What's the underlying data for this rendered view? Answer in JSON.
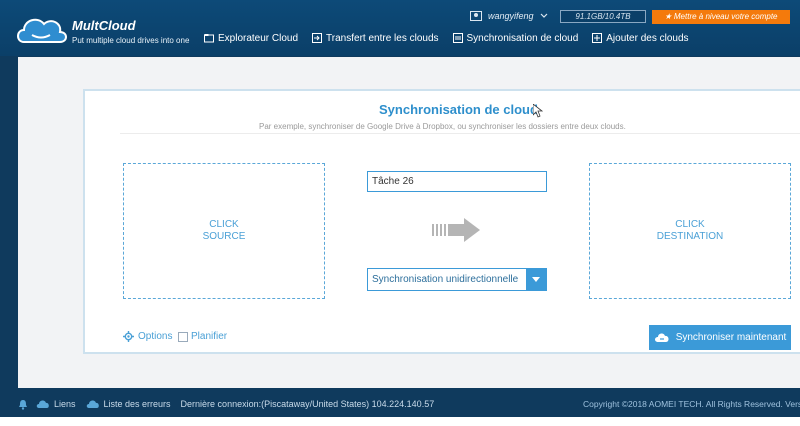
{
  "header": {
    "brand": "MultCloud",
    "tagline": "Put multiple cloud drives into one",
    "username": "wangyifeng",
    "quota": "91.1GB/10.4TB",
    "upgrade_label": "★ Mettre à niveau votre compte",
    "nav": [
      {
        "label": "Explorateur Cloud",
        "icon": "folder-icon"
      },
      {
        "label": "Transfert entre les clouds",
        "icon": "transfer-icon"
      },
      {
        "label": "Synchronisation de cloud",
        "icon": "sync-icon"
      },
      {
        "label": "Ajouter des clouds",
        "icon": "add-cloud-icon"
      }
    ]
  },
  "panel": {
    "title": "Synchronisation de cloud",
    "subtitle": "Par exemple, synchroniser de Google Drive à Dropbox, ou synchroniser les dossiers entre deux clouds.",
    "source_line1": "CLICK",
    "source_line2": "SOURCE",
    "dest_line1": "CLICK",
    "dest_line2": "DESTINATION",
    "task_name": "Tâche 26",
    "mode": "Synchronisation unidirectionnelle",
    "options_label": "Options",
    "schedule_label": "Planifier",
    "sync_button": "Synchroniser maintenant"
  },
  "footer": {
    "links_label": "Liens",
    "errors_label": "Liste des erreurs",
    "last_login": "Dernière connexion:(Piscataway/United States) 104.224.140.57",
    "copyright": "Copyright ©2018 AOMEI TECH. All Rights Reserved. Vers"
  },
  "colors": {
    "header_bg": "#0b3f68",
    "accent": "#3b9ad8",
    "upgrade": "#f47a0c"
  }
}
